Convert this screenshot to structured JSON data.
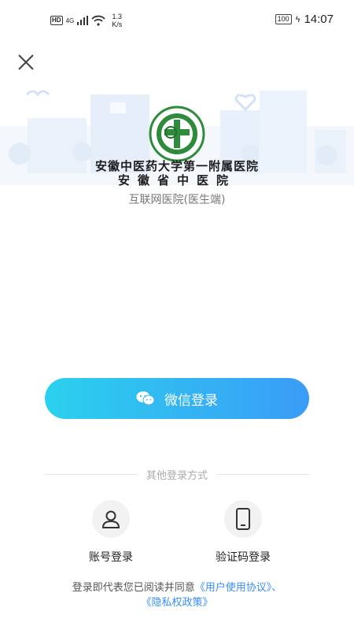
{
  "status_bar": {
    "hd": "HD",
    "network": "4G",
    "speed_value": "1.3",
    "speed_unit": "K/s",
    "battery": "100",
    "time": "14:07"
  },
  "header": {
    "hospital_name_line1": "安徽中医药大学第一附属医院",
    "hospital_name_line2": "安徽省中医院",
    "subtitle": "互联网医院(医生端)"
  },
  "main": {
    "wechat_login_label": "微信登录",
    "other_methods_label": "其他登录方式",
    "options": [
      {
        "label": "账号登录",
        "icon": "person-icon"
      },
      {
        "label": "验证码登录",
        "icon": "phone-icon"
      }
    ]
  },
  "agreement": {
    "prefix": "登录即代表您已阅读并同意",
    "user_agreement": "《用户使用协议》",
    "separator": "、",
    "privacy_policy": "《隐私权政策》"
  },
  "colors": {
    "accent_start": "#2bd1ee",
    "accent_end": "#3a9cf7",
    "link": "#3a8ef7",
    "logo_green": "#2e8b3c"
  }
}
